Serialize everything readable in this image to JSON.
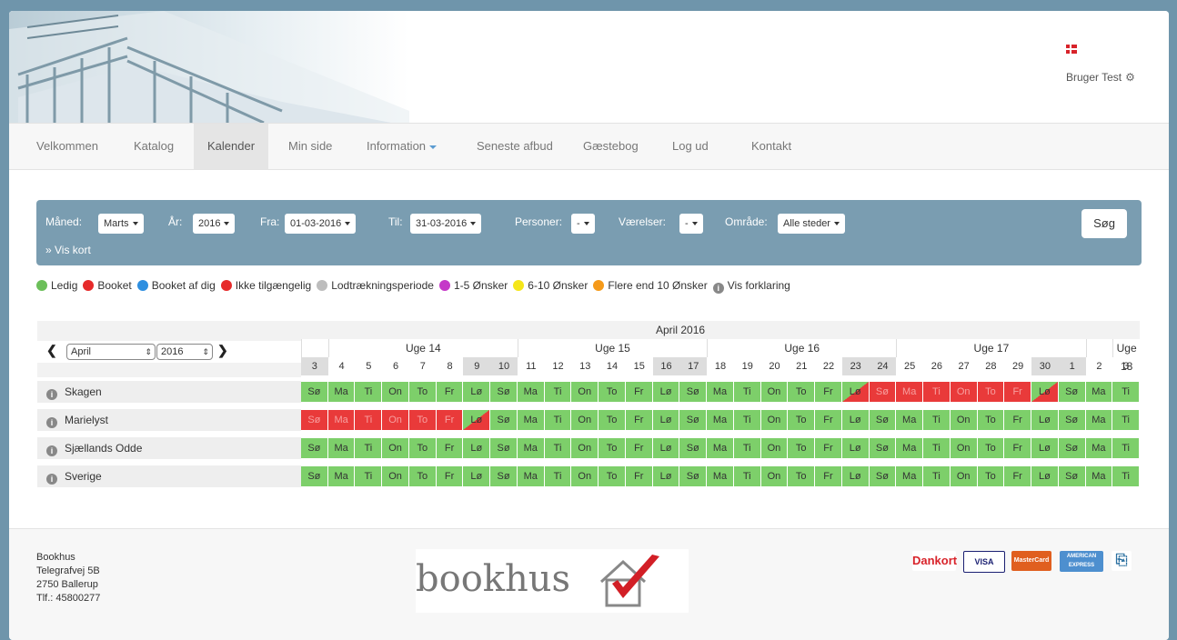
{
  "header": {
    "user_label": "Bruger Test",
    "flag_icon": "danish-flag-icon",
    "settings_icon": "gear-icon"
  },
  "nav": {
    "items": [
      {
        "label": "Velkommen"
      },
      {
        "label": "Katalog"
      },
      {
        "label": "Kalender",
        "active": true
      },
      {
        "label": "Min side"
      },
      {
        "label": "Information",
        "dropdown": true
      },
      {
        "label": "Seneste afbud"
      },
      {
        "label": "Gæstebog"
      },
      {
        "label": "Log ud"
      },
      {
        "label": "Kontakt"
      }
    ]
  },
  "filter": {
    "month_label": "Måned:",
    "month_value": "Marts",
    "year_label": "År:",
    "year_value": "2016",
    "from_label": "Fra:",
    "from_value": "01-03-2016",
    "to_label": "Til:",
    "to_value": "31-03-2016",
    "persons_label": "Personer:",
    "persons_value": "-",
    "rooms_label": "Værelser:",
    "rooms_value": "-",
    "area_label": "Område:",
    "area_value": "Alle steder",
    "show_map": "» Vis kort",
    "search_button": "Søg"
  },
  "legend": [
    {
      "label": "Ledig",
      "color": "#6cbf5a"
    },
    {
      "label": "Booket",
      "color": "#e62b2b"
    },
    {
      "label": "Booket af dig",
      "color": "#2e8fe0"
    },
    {
      "label": "Ikke tilgængelig",
      "color": "#e62b2b"
    },
    {
      "label": "Lodtrækningsperiode",
      "color": "#bdbdbd"
    },
    {
      "label": "1-5 Ønsker",
      "color": "#c538c8"
    },
    {
      "label": "6-10 Ønsker",
      "color": "#f5e61a"
    },
    {
      "label": "Flere end 10 Ønsker",
      "color": "#f59a1a"
    },
    {
      "label": "Vis forklaring",
      "color": "info"
    }
  ],
  "calendar": {
    "month_select": "April",
    "year_select": "2016",
    "month_title": "April 2016",
    "weeks": [
      {
        "label": ""
      },
      {
        "label": "Uge 14"
      },
      {
        "label": "Uge 15"
      },
      {
        "label": "Uge 16"
      },
      {
        "label": "Uge 17"
      },
      {
        "label": ""
      },
      {
        "label": "Uge 18"
      }
    ],
    "days": [
      "3",
      "4",
      "5",
      "6",
      "7",
      "8",
      "9",
      "10",
      "11",
      "12",
      "13",
      "14",
      "15",
      "16",
      "17",
      "18",
      "19",
      "20",
      "21",
      "22",
      "23",
      "24",
      "25",
      "26",
      "27",
      "28",
      "29",
      "30",
      "1",
      "2",
      "3"
    ],
    "weekend_days": [
      0,
      6,
      7,
      13,
      14,
      20,
      21,
      27,
      28
    ],
    "day_abbr": [
      "Sø",
      "Ma",
      "Ti",
      "On",
      "To",
      "Fr",
      "Lø",
      "Sø",
      "Ma",
      "Ti",
      "On",
      "To",
      "Fr",
      "Lø",
      "Sø",
      "Ma",
      "Ti",
      "On",
      "To",
      "Fr",
      "Lø",
      "Sø",
      "Ma",
      "Ti",
      "On",
      "To",
      "Fr",
      "Lø",
      "Sø",
      "Ma",
      "Ti"
    ],
    "resources": [
      {
        "name": "Skagen",
        "status": "GGGGGGGGGGGGGGGGGGGGHBBBBBBHGGG"
      },
      {
        "name": "Marielyst",
        "status": "BBBBBBHGGGGGGGGGGGGGGGGGGGGGGGG"
      },
      {
        "name": "Sjællands Odde",
        "status": "GGGGGGGGGGGGGGGGGGGGGGGGGGGGGGG"
      },
      {
        "name": "Sverige",
        "status": "GGGGGGGGGGGGGGGGGGGGGGGGGGGGGGG"
      }
    ]
  },
  "footer": {
    "address": [
      "Bookhus",
      "Telegrafvej 5B",
      "2750 Ballerup",
      "Tlf.: 45800277"
    ],
    "logo_text": "bookhus",
    "payment_cards": [
      "Dankort",
      "VISA",
      "MasterCard",
      "AMERICAN EXPRESS",
      "card-icon"
    ]
  }
}
